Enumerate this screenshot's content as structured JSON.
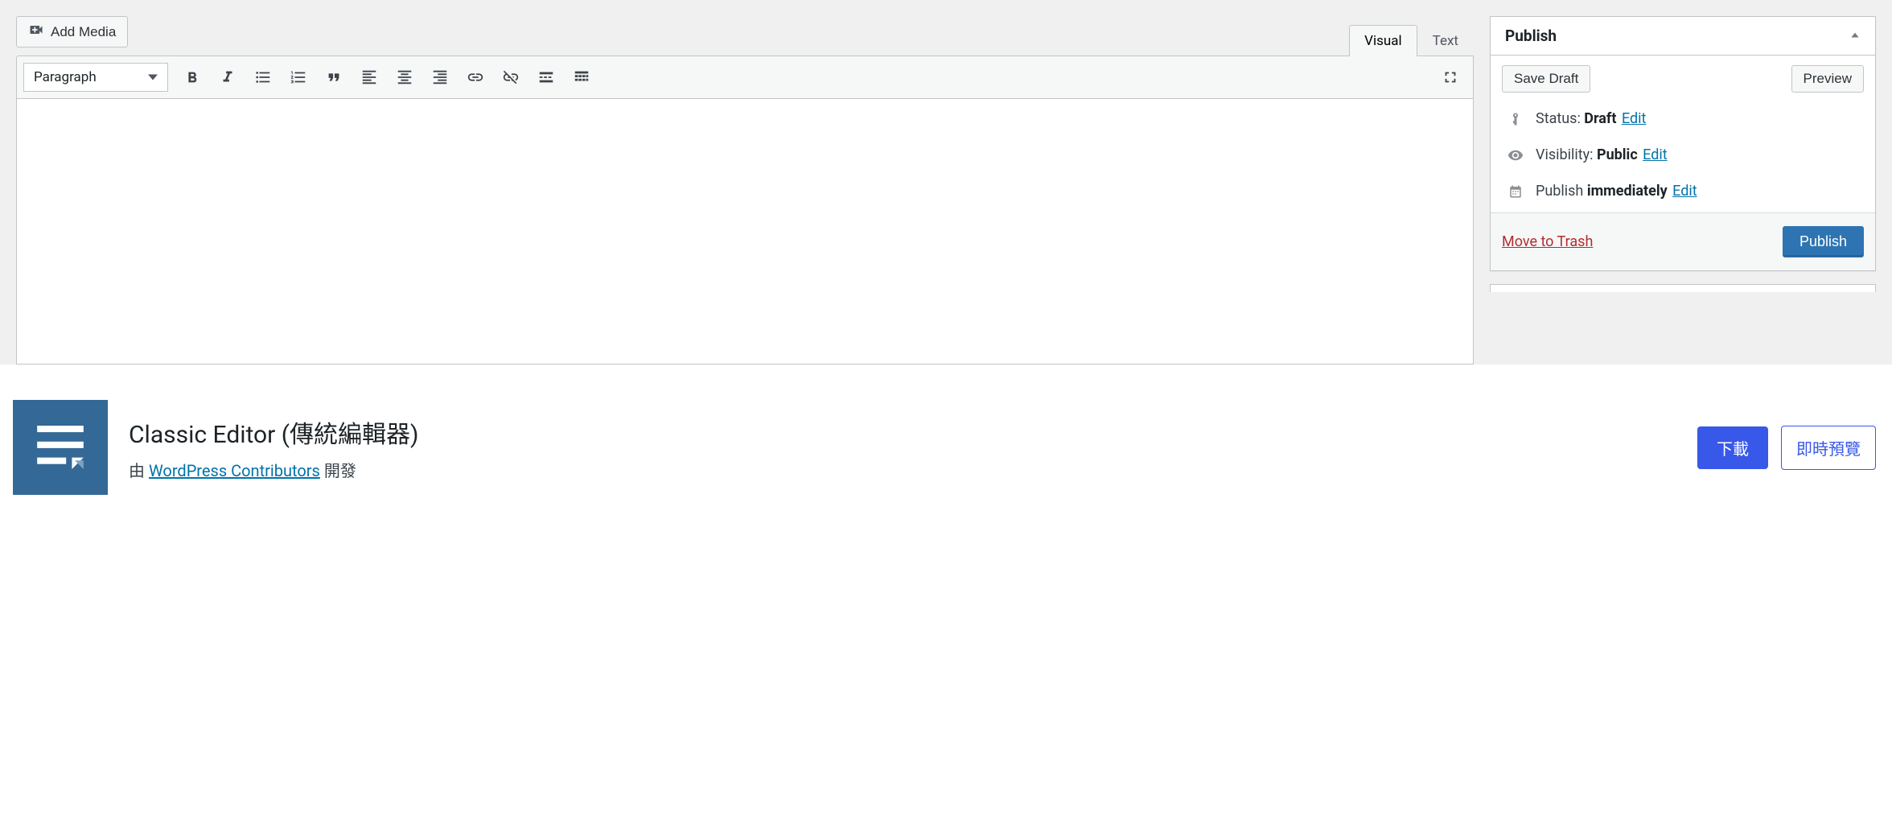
{
  "editor": {
    "add_media": "Add Media",
    "tabs": {
      "visual": "Visual",
      "text": "Text"
    },
    "formatselect": "Paragraph"
  },
  "publish": {
    "title": "Publish",
    "save_draft": "Save Draft",
    "preview": "Preview",
    "status_label": "Status:",
    "status_value": "Draft",
    "visibility_label": "Visibility:",
    "visibility_value": "Public",
    "publish_label": "Publish",
    "publish_value": "immediately",
    "edit": "Edit",
    "move_to_trash": "Move to Trash",
    "publish_btn": "Publish"
  },
  "plugin": {
    "title": "Classic Editor (傳統編輯器)",
    "by_prefix": "由 ",
    "author": "WordPress Contributors",
    "by_suffix": " 開發",
    "download": "下載",
    "live_preview": "即時預覽"
  }
}
